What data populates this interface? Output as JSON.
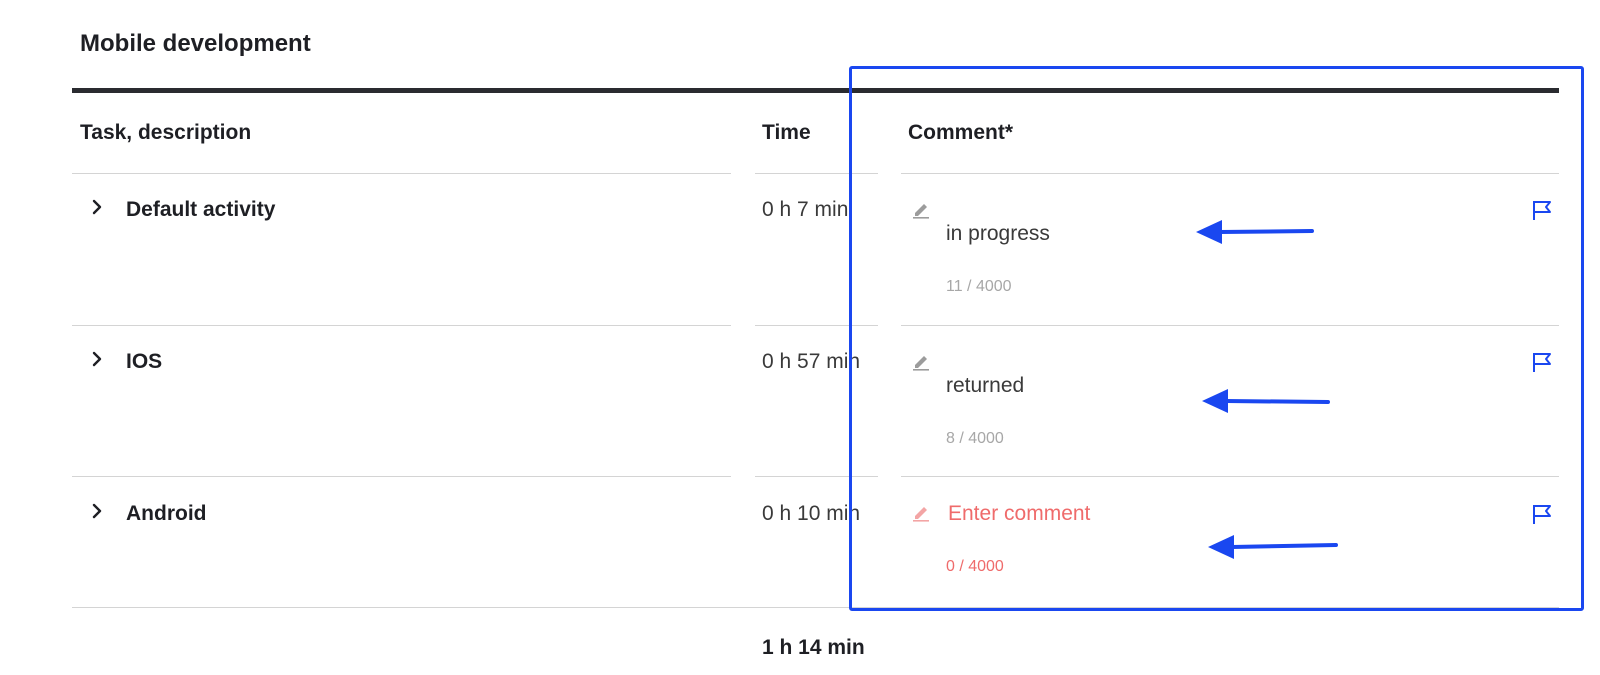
{
  "section": {
    "title": "Mobile development"
  },
  "table": {
    "headers": {
      "task": "Task, description",
      "time": "Time",
      "comment": "Comment*"
    },
    "rows": [
      {
        "task": "Default activity",
        "time": "0 h 7 min",
        "comment": "in progress",
        "counter": "11 / 4000",
        "error": false
      },
      {
        "task": "IOS",
        "time": "0 h 57 min",
        "comment": "returned",
        "counter": "8 / 4000",
        "error": false
      },
      {
        "task": "Android",
        "time": "0 h 10 min",
        "comment_placeholder": "Enter comment",
        "counter": "0 / 4000",
        "error": true
      }
    ],
    "total": "1 h 14 min"
  },
  "icons": {
    "expand": "chevron-right-icon",
    "edit": "pencil-icon",
    "flag": "flag-icon",
    "annotation": "arrow-left-icon"
  },
  "colors": {
    "accent": "#1a47f0",
    "error": "#ef6b6b",
    "text": "#1e1f24"
  }
}
